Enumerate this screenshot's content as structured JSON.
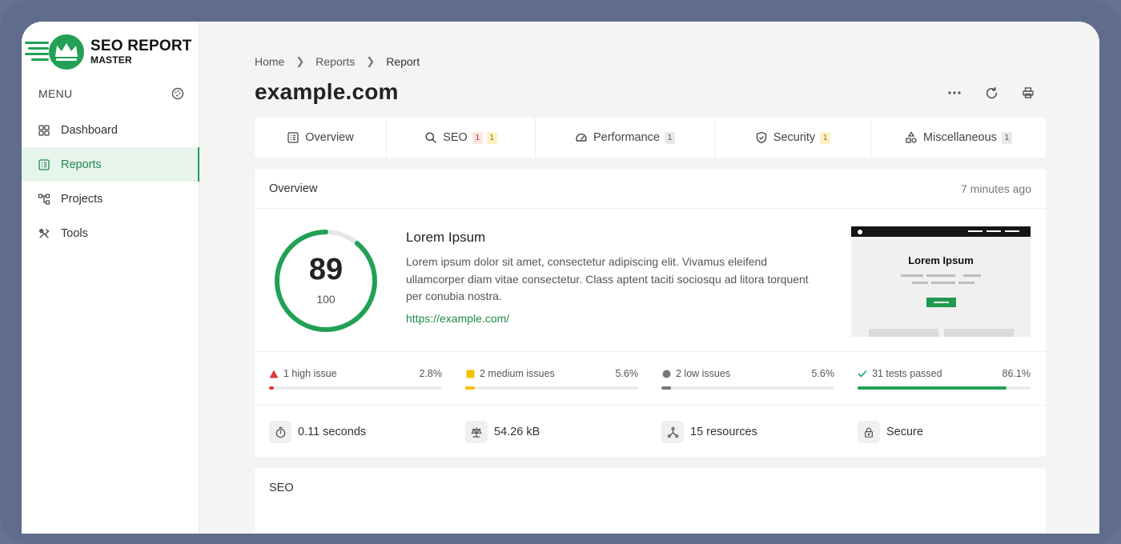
{
  "brand": {
    "line1": "SEO REPORT",
    "line2": "MASTER",
    "accent": "#22a055"
  },
  "sidebar": {
    "menu_label": "MENU",
    "items": [
      {
        "label": "Dashboard",
        "icon": "grid-icon",
        "active": false
      },
      {
        "label": "Reports",
        "icon": "report-icon",
        "active": true
      },
      {
        "label": "Projects",
        "icon": "projects-icon",
        "active": false
      },
      {
        "label": "Tools",
        "icon": "tools-icon",
        "active": false
      }
    ]
  },
  "breadcrumb": [
    "Home",
    "Report",
    "Report"
  ],
  "breadcrumb_items": {
    "home": "Home",
    "reports": "Reports",
    "current": "Report"
  },
  "page": {
    "title": "example.com"
  },
  "tabs": [
    {
      "label": "Overview",
      "icon": "list-icon"
    },
    {
      "label": "SEO",
      "icon": "search-icon",
      "badges": [
        "1",
        "1"
      ]
    },
    {
      "label": "Performance",
      "icon": "speedometer-icon",
      "badges": [
        "1"
      ]
    },
    {
      "label": "Security",
      "icon": "shield-icon",
      "badges": [
        "1"
      ]
    },
    {
      "label": "Miscellaneous",
      "icon": "shapes-icon",
      "badges": [
        "1"
      ]
    }
  ],
  "overview": {
    "title": "Overview",
    "time": "7 minutes ago",
    "score": "89",
    "max": "100",
    "score_fraction": 0.89,
    "site_title": "Lorem Ipsum",
    "description": "Lorem ipsum dolor sit amet, consectetur adipiscing elit. Vivamus eleifend ullamcorper diam vitae consectetur. Class aptent taciti sociosqu ad litora torquent per conubia nostra.",
    "url": "https://example.com/",
    "preview_title": "Lorem Ipsum"
  },
  "issues": [
    {
      "label": "1 high issue",
      "percent": "2.8%",
      "value": 2.8,
      "color": "#d93b3b"
    },
    {
      "label": "2 medium issues",
      "percent": "5.6%",
      "value": 5.6,
      "color": "#f2c200"
    },
    {
      "label": "2 low issues",
      "percent": "5.6%",
      "value": 5.6,
      "color": "#777777"
    },
    {
      "label": "31 tests passed",
      "percent": "86.1%",
      "value": 86.1,
      "color": "#22a055"
    }
  ],
  "stats": [
    {
      "label": "0.11 seconds",
      "icon": "stopwatch-icon"
    },
    {
      "label": "54.26 kB",
      "icon": "scale-icon"
    },
    {
      "label": "15 resources",
      "icon": "network-icon"
    },
    {
      "label": "Secure",
      "icon": "lock-icon"
    }
  ],
  "seo_section": {
    "title": "SEO"
  }
}
